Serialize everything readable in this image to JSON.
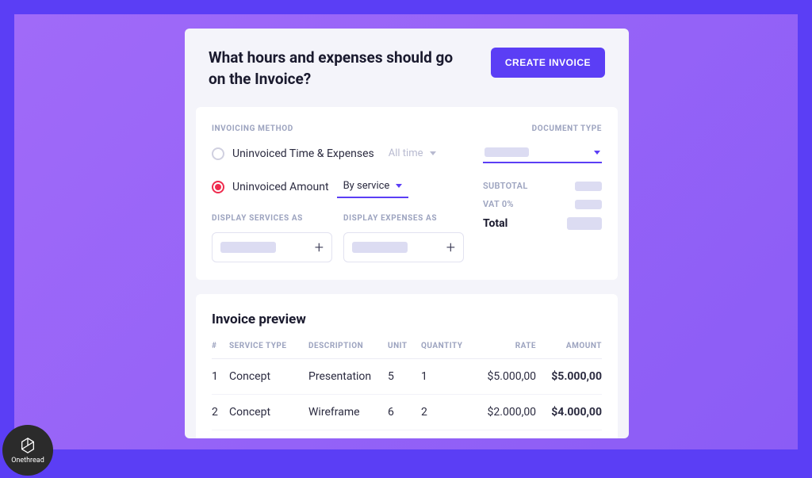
{
  "header": {
    "title": "What hours and expenses should go on the Invoice?",
    "create_button": "CREATE INVOICE"
  },
  "invoicing_method": {
    "label": "INVOICING METHOD",
    "options": [
      {
        "label": "Uninvoiced Time & Expenses",
        "selected": false,
        "range_label": "All time"
      },
      {
        "label": "Uninvoiced Amount",
        "selected": true,
        "range_label": "By service"
      }
    ]
  },
  "display_services": {
    "label": "DISPLAY SERVICES AS"
  },
  "display_expenses": {
    "label": "DISPLAY EXPENSES AS"
  },
  "document_type": {
    "label": "DOCUMENT TYPE"
  },
  "totals": {
    "subtotal_label": "SUBTOTAL",
    "vat_label": "VAT 0%",
    "total_label": "Total"
  },
  "preview": {
    "title": "Invoice preview",
    "columns": {
      "num": "#",
      "service_type": "SERVICE TYPE",
      "description": "DESCRIPTION",
      "unit": "UNIT",
      "quantity": "QUANTITY",
      "rate": "RATE",
      "amount": "AMOUNT"
    },
    "rows": [
      {
        "num": "1",
        "service_type": "Concept",
        "description": "Presentation",
        "unit": "5",
        "quantity": "1",
        "rate": "$5.000,00",
        "amount": "$5.000,00"
      },
      {
        "num": "2",
        "service_type": "Concept",
        "description": "Wireframe",
        "unit": "6",
        "quantity": "2",
        "rate": "$2.000,00",
        "amount": "$4.000,00"
      }
    ]
  },
  "brand": {
    "name": "Onethread"
  }
}
